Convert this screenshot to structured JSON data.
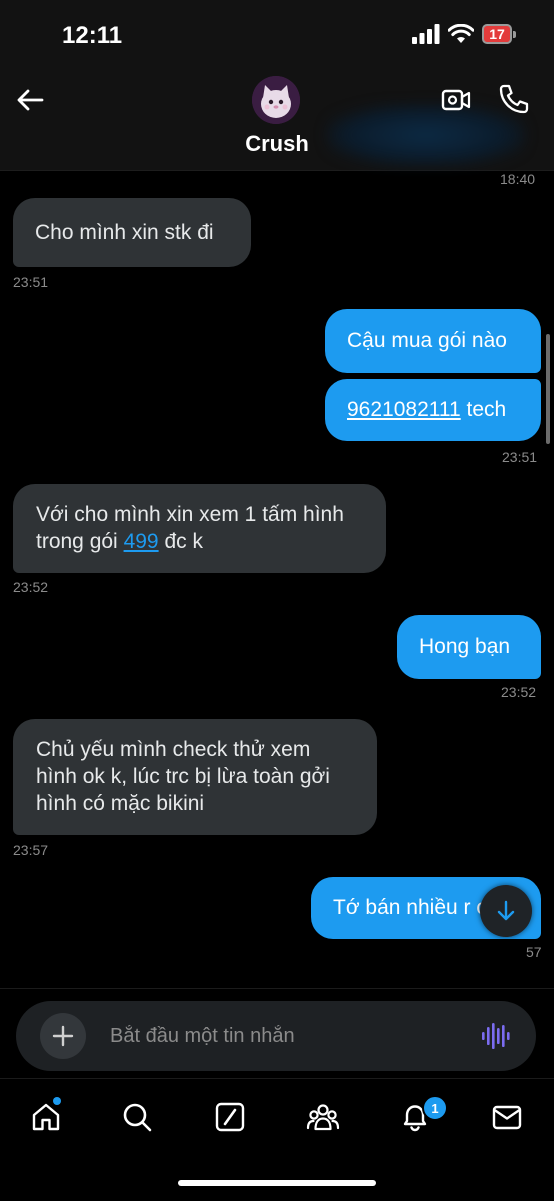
{
  "status_bar": {
    "time": "12:11",
    "battery_level": "17",
    "battery_color": "#e33b3b"
  },
  "header": {
    "contact_name": "Crush",
    "last_seen_time": "18:40"
  },
  "messages": [
    {
      "dir": "in",
      "text": "Cho mình xin stk đi",
      "time": "23:51"
    },
    {
      "dir": "out",
      "text": "Cậu mua gói nào"
    },
    {
      "dir": "out",
      "link": "9621082111",
      "text_after": " tech",
      "time": "23:51"
    },
    {
      "dir": "in",
      "line1": "Với cho mình xin xem 1 tấm hình",
      "line2_before": "trong gói ",
      "link": "499",
      "line2_after": " đc k",
      "time": "23:52"
    },
    {
      "dir": "out",
      "text": "Hong bạn",
      "time": "23:52"
    },
    {
      "dir": "in",
      "lines": [
        "Chủ yếu mình check thử xem",
        "hình ok k, lúc trc bị lừa toàn gởi",
        "hình có mặc bikini"
      ],
      "time": "23:57"
    },
    {
      "dir": "out",
      "text": "Tớ bán nhiều r cậu",
      "time_partial": "57"
    }
  ],
  "composer": {
    "placeholder": "Bắt đầu một tin nhắn"
  },
  "tabbar": {
    "notifications_badge": "1"
  },
  "colors": {
    "accent": "#1d9bf0",
    "incoming_bubble": "#2f3336",
    "background": "#000000",
    "voice_icon": "#7b6cf0"
  }
}
